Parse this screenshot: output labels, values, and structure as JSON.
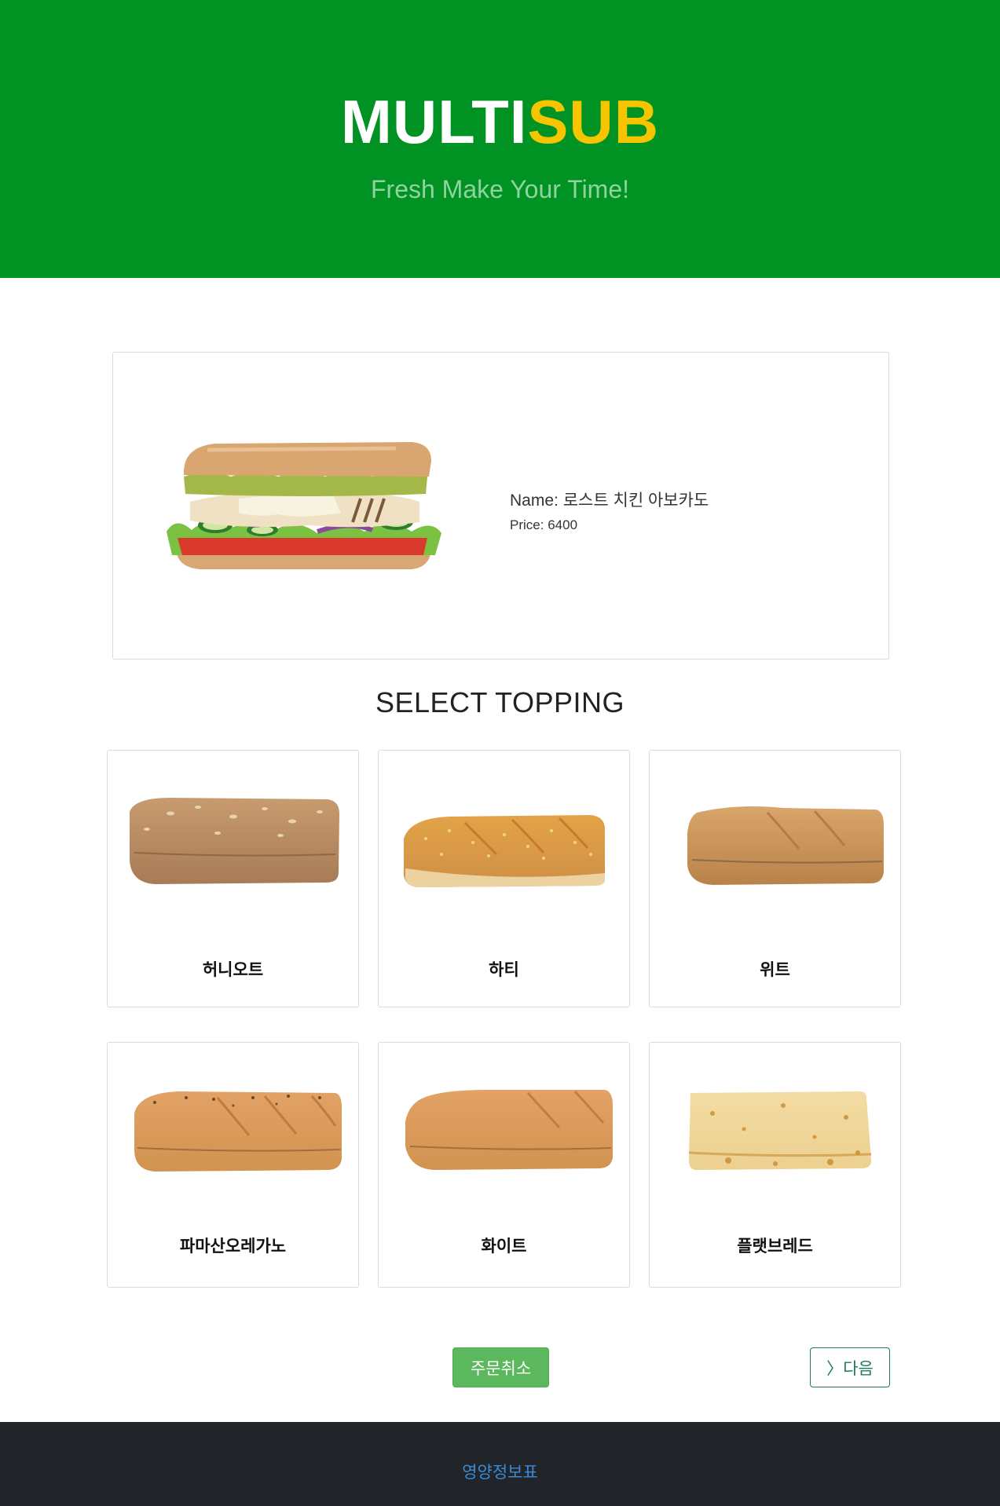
{
  "header": {
    "logo_part1": "MULTI",
    "logo_part2": "SUB",
    "tagline": "Fresh Make Your Time!"
  },
  "product": {
    "name_label": "Name:",
    "name": "로스트 치킨 아보카도",
    "price_label": "Price:",
    "price": "6400"
  },
  "section_title": "SELECT TOPPING",
  "toppings": [
    {
      "label": "허니오트",
      "icon": "honey-oat-bread-icon"
    },
    {
      "label": "하티",
      "icon": "hearty-bread-icon"
    },
    {
      "label": "위트",
      "icon": "wheat-bread-icon"
    },
    {
      "label": "파마산오레가노",
      "icon": "parmesan-oregano-bread-icon"
    },
    {
      "label": "화이트",
      "icon": "white-bread-icon"
    },
    {
      "label": "플랫브레드",
      "icon": "flatbread-icon"
    }
  ],
  "actions": {
    "cancel_label": "주문취소",
    "next_label": "〉다음"
  },
  "footer": {
    "link_label": "영양정보표"
  },
  "colors": {
    "brand_green": "#009223",
    "brand_yellow": "#f7c500",
    "footer_bg": "#212529",
    "cancel_green": "#5cb85c"
  }
}
